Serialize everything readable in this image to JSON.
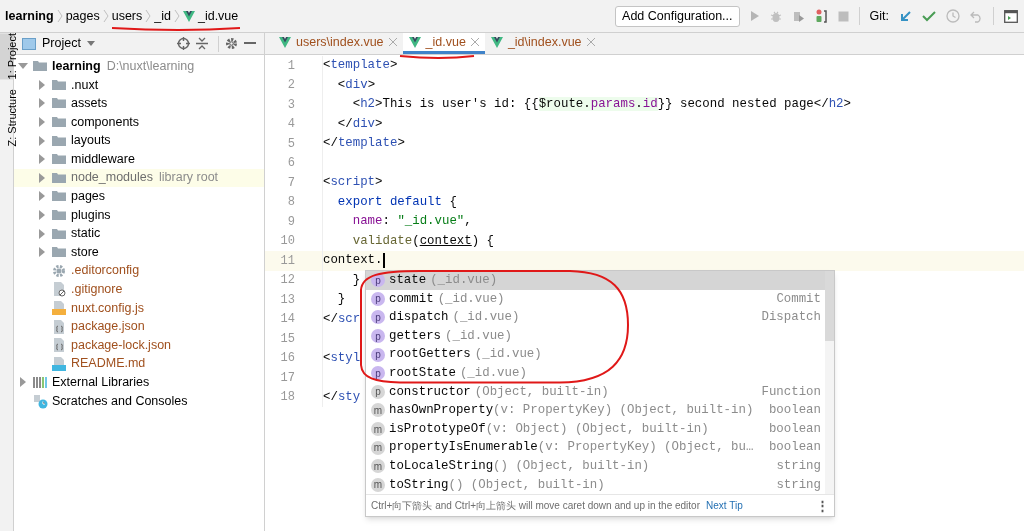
{
  "breadcrumbs": [
    {
      "kind": "project",
      "label": "learning",
      "bold": true
    },
    {
      "kind": "folder",
      "label": "pages",
      "bold": false
    },
    {
      "kind": "folder",
      "label": "users",
      "bold": false
    },
    {
      "kind": "folder",
      "label": "_id",
      "bold": false
    },
    {
      "kind": "vue-file",
      "label": "_id.vue",
      "bold": false
    }
  ],
  "toolbar": {
    "config_button": "Add Configuration...",
    "git_label": "Git:"
  },
  "side_tabs": [
    {
      "label": "1: Project",
      "selected": true
    },
    {
      "label": "Z: Structure",
      "selected": false
    }
  ],
  "project_panel": {
    "title": "Project",
    "tree": [
      {
        "kind": "root",
        "label": "learning",
        "note": "D:\\nuxt\\learning",
        "expanded": true,
        "children": [
          {
            "kind": "folder",
            "label": ".nuxt",
            "expanded": false,
            "untracked": false
          },
          {
            "kind": "folder",
            "label": "assets",
            "expanded": false,
            "untracked": false
          },
          {
            "kind": "folder",
            "label": "components",
            "expanded": false,
            "untracked": false
          },
          {
            "kind": "folder",
            "label": "layouts",
            "expanded": false,
            "untracked": false
          },
          {
            "kind": "folder",
            "label": "middleware",
            "expanded": false,
            "untracked": false
          },
          {
            "kind": "library",
            "label": "node_modules",
            "note": "library root",
            "expanded": false,
            "untracked": false
          },
          {
            "kind": "folder",
            "label": "pages",
            "expanded": false,
            "untracked": false
          },
          {
            "kind": "folder",
            "label": "plugins",
            "expanded": false,
            "untracked": false
          },
          {
            "kind": "folder",
            "label": "static",
            "expanded": false,
            "untracked": false
          },
          {
            "kind": "folder",
            "label": "store",
            "expanded": false,
            "untracked": false
          },
          {
            "kind": "config",
            "label": ".editorconfig",
            "untracked": true
          },
          {
            "kind": "ignore",
            "label": ".gitignore",
            "untracked": true
          },
          {
            "kind": "js",
            "label": "nuxt.config.js",
            "untracked": true
          },
          {
            "kind": "json",
            "label": "package.json",
            "untracked": true
          },
          {
            "kind": "json",
            "label": "package-lock.json",
            "untracked": true
          },
          {
            "kind": "md",
            "label": "README.md",
            "untracked": true
          }
        ]
      },
      {
        "kind": "libraries",
        "label": "External Libraries",
        "expanded": false
      },
      {
        "kind": "scratches",
        "label": "Scratches and Consoles"
      }
    ]
  },
  "editor_tabs": [
    {
      "label": "users\\index.vue",
      "selected": false
    },
    {
      "label": "_id.vue",
      "selected": true
    },
    {
      "label": "_id\\index.vue",
      "selected": false
    }
  ],
  "code_lines": [
    {
      "number": "1",
      "current": false,
      "tokens": [
        {
          "kind": "plain",
          "text": "<"
        },
        {
          "kind": "tag",
          "text": "template"
        },
        {
          "kind": "plain",
          "text": ">"
        }
      ]
    },
    {
      "number": "2",
      "current": false,
      "tokens": [
        {
          "kind": "plain",
          "text": "  <"
        },
        {
          "kind": "tag",
          "text": "div"
        },
        {
          "kind": "plain",
          "text": ">"
        }
      ]
    },
    {
      "number": "3",
      "current": false,
      "tokens": [
        {
          "kind": "plain",
          "text": "    <"
        },
        {
          "kind": "tag",
          "text": "h2"
        },
        {
          "kind": "plain",
          "text": ">This is user's id: {{"
        },
        {
          "kind": "interp",
          "text": "$route."
        },
        {
          "kind": "interp-prop",
          "text": "params"
        },
        {
          "kind": "interp",
          "text": "."
        },
        {
          "kind": "interp-prop",
          "text": "id"
        },
        {
          "kind": "plain",
          "text": "}} second nested page</"
        },
        {
          "kind": "tag",
          "text": "h2"
        },
        {
          "kind": "plain",
          "text": ">"
        }
      ]
    },
    {
      "number": "4",
      "current": false,
      "tokens": [
        {
          "kind": "plain",
          "text": "  </"
        },
        {
          "kind": "tag",
          "text": "div"
        },
        {
          "kind": "plain",
          "text": ">"
        }
      ]
    },
    {
      "number": "5",
      "current": false,
      "tokens": [
        {
          "kind": "plain",
          "text": "</"
        },
        {
          "kind": "tag",
          "text": "template"
        },
        {
          "kind": "plain",
          "text": ">"
        }
      ]
    },
    {
      "number": "6",
      "current": false
    },
    {
      "number": "7",
      "current": false,
      "tokens": [
        {
          "kind": "plain",
          "text": "<"
        },
        {
          "kind": "tag",
          "text": "script"
        },
        {
          "kind": "plain",
          "text": ">"
        }
      ]
    },
    {
      "number": "8",
      "current": false,
      "tokens": [
        {
          "kind": "keyword",
          "text": "  export default "
        },
        {
          "kind": "plain",
          "text": "{"
        }
      ]
    },
    {
      "number": "9",
      "current": false,
      "tokens": [
        {
          "kind": "prop",
          "text": "    name"
        },
        {
          "kind": "plain",
          "text": ": "
        },
        {
          "kind": "string",
          "text": "\"_id.vue\""
        },
        {
          "kind": "plain",
          "text": ","
        }
      ]
    },
    {
      "number": "10",
      "current": false,
      "tokens": [
        {
          "kind": "func",
          "text": "    validate"
        },
        {
          "kind": "plain",
          "text": "("
        },
        {
          "kind": "param",
          "text": "context"
        },
        {
          "kind": "plain",
          "text": ") {"
        }
      ]
    },
    {
      "number": "11",
      "current": true,
      "tokens": [
        {
          "kind": "plain",
          "text": "context."
        }
      ]
    },
    {
      "number": "12",
      "current": false,
      "tokens": [
        {
          "kind": "plain",
          "text": "    }"
        }
      ]
    },
    {
      "number": "13",
      "current": false,
      "tokens": [
        {
          "kind": "plain",
          "text": "  }"
        }
      ]
    },
    {
      "number": "14",
      "current": false,
      "tokens": [
        {
          "kind": "plain",
          "text": "</"
        },
        {
          "kind": "tag",
          "text": "scr"
        }
      ]
    },
    {
      "number": "15",
      "current": false
    },
    {
      "number": "16",
      "current": false,
      "tokens": [
        {
          "kind": "plain",
          "text": "<"
        },
        {
          "kind": "tag",
          "text": "styl"
        }
      ]
    },
    {
      "number": "17",
      "current": false
    },
    {
      "number": "18",
      "current": false,
      "tokens": [
        {
          "kind": "plain",
          "text": "</"
        },
        {
          "kind": "tag",
          "text": "sty"
        }
      ]
    }
  ],
  "completion": {
    "items": [
      {
        "kind": "vue",
        "icon": "p",
        "name": "state",
        "detail": "(_id.vue)",
        "selected": true
      },
      {
        "kind": "vue",
        "icon": "p",
        "name": "commit",
        "detail": "(_id.vue)",
        "type": "Commit",
        "selected": false
      },
      {
        "kind": "vue",
        "icon": "p",
        "name": "dispatch",
        "detail": "(_id.vue)",
        "type": "Dispatch",
        "selected": false
      },
      {
        "kind": "vue",
        "icon": "p",
        "name": "getters",
        "detail": "(_id.vue)",
        "selected": false
      },
      {
        "kind": "vue",
        "icon": "p",
        "name": "rootGetters",
        "detail": "(_id.vue)",
        "selected": false
      },
      {
        "kind": "vue",
        "icon": "p",
        "name": "rootState",
        "detail": "(_id.vue)",
        "selected": false
      },
      {
        "kind": "builtin",
        "icon": "p",
        "name": "constructor",
        "detail": "(Object, built-in)",
        "type": "Function",
        "selected": false
      },
      {
        "kind": "builtin",
        "icon": "m",
        "name": "hasOwnProperty",
        "detail": "(v: PropertyKey) (Object, built-in)",
        "type": "boolean",
        "selected": false
      },
      {
        "kind": "builtin",
        "icon": "m",
        "name": "isPrototypeOf",
        "detail": "(v: Object) (Object, built-in)",
        "type": "boolean",
        "selected": false
      },
      {
        "kind": "builtin",
        "icon": "m",
        "name": "propertyIsEnumerable",
        "detail": "(v: PropertyKey) (Object, bu…",
        "type": "boolean",
        "selected": false
      },
      {
        "kind": "builtin",
        "icon": "m",
        "name": "toLocaleString",
        "detail": "() (Object, built-in)",
        "type": "string",
        "selected": false
      },
      {
        "kind": "builtin",
        "icon": "m",
        "name": "toString",
        "detail": "() (Object, built-in)",
        "type": "string",
        "selected": false
      }
    ],
    "tip": "Ctrl+向下箭头 and Ctrl+向上箭头 will move caret down and up in the editor",
    "tip_link": "Next Tip",
    "menu": "⋮"
  }
}
